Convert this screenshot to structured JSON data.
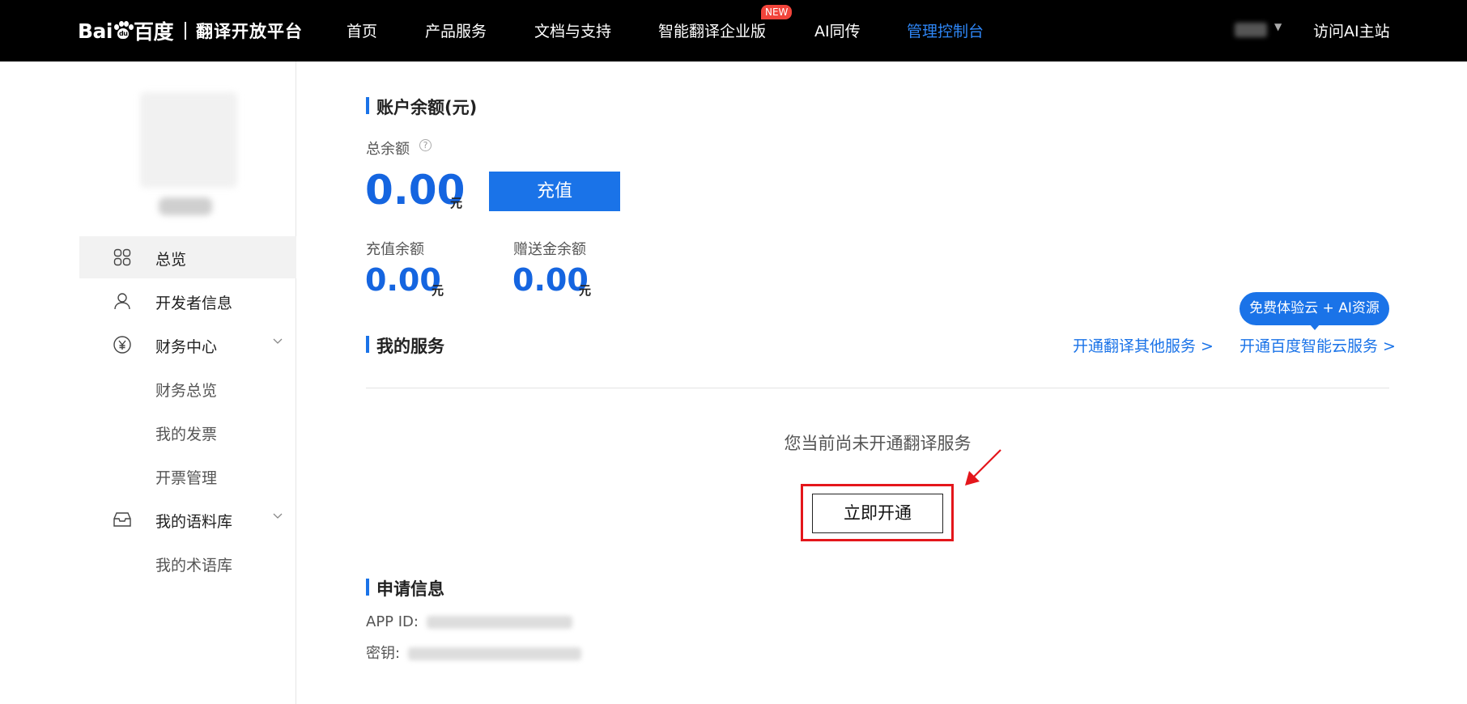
{
  "brand": {
    "logo_text_left": "Bai",
    "logo_paw_text": "du",
    "logo_text_right": "百度",
    "platform": "翻译开放平台"
  },
  "nav": {
    "items": [
      {
        "label": "首页"
      },
      {
        "label": "产品服务"
      },
      {
        "label": "文档与支持"
      },
      {
        "label": "智能翻译企业版"
      },
      {
        "label": "AI同传"
      },
      {
        "label": "管理控制台"
      }
    ],
    "new_badge": "NEW",
    "visit_link": "访问AI主站"
  },
  "sidebar": {
    "items": [
      {
        "label": "总览",
        "icon": "grid-icon"
      },
      {
        "label": "开发者信息",
        "icon": "user-icon"
      },
      {
        "label": "财务中心",
        "icon": "yen-circle-icon"
      },
      {
        "label": "我的语料库",
        "icon": "inbox-icon"
      }
    ],
    "finance_sub": [
      "财务总览",
      "我的发票",
      "开票管理"
    ],
    "corpus_sub": [
      "我的术语库"
    ]
  },
  "balance": {
    "title": "账户余额(元)",
    "total_label": "总余额",
    "total_value": "0.00",
    "unit": "元",
    "recharge_button": "充值",
    "recharge_label": "充值余额",
    "recharge_value": "0.00",
    "gift_label": "赠送金余额",
    "gift_value": "0.00"
  },
  "services": {
    "title": "我的服务",
    "tooltip": "免费体验云 + AI资源",
    "link_other": "开通翻译其他服务 >",
    "link_cloud": "开通百度智能云服务 >",
    "empty_message": "您当前尚未开通翻译服务",
    "open_button": "立即开通"
  },
  "application": {
    "title": "申请信息",
    "app_id_label": "APP ID:",
    "secret_label": "密钥:"
  },
  "colors": {
    "accent": "#1a73e8",
    "nav_active": "#2e86f6",
    "badge": "#f2443b",
    "highlight_red": "#e4161b"
  }
}
